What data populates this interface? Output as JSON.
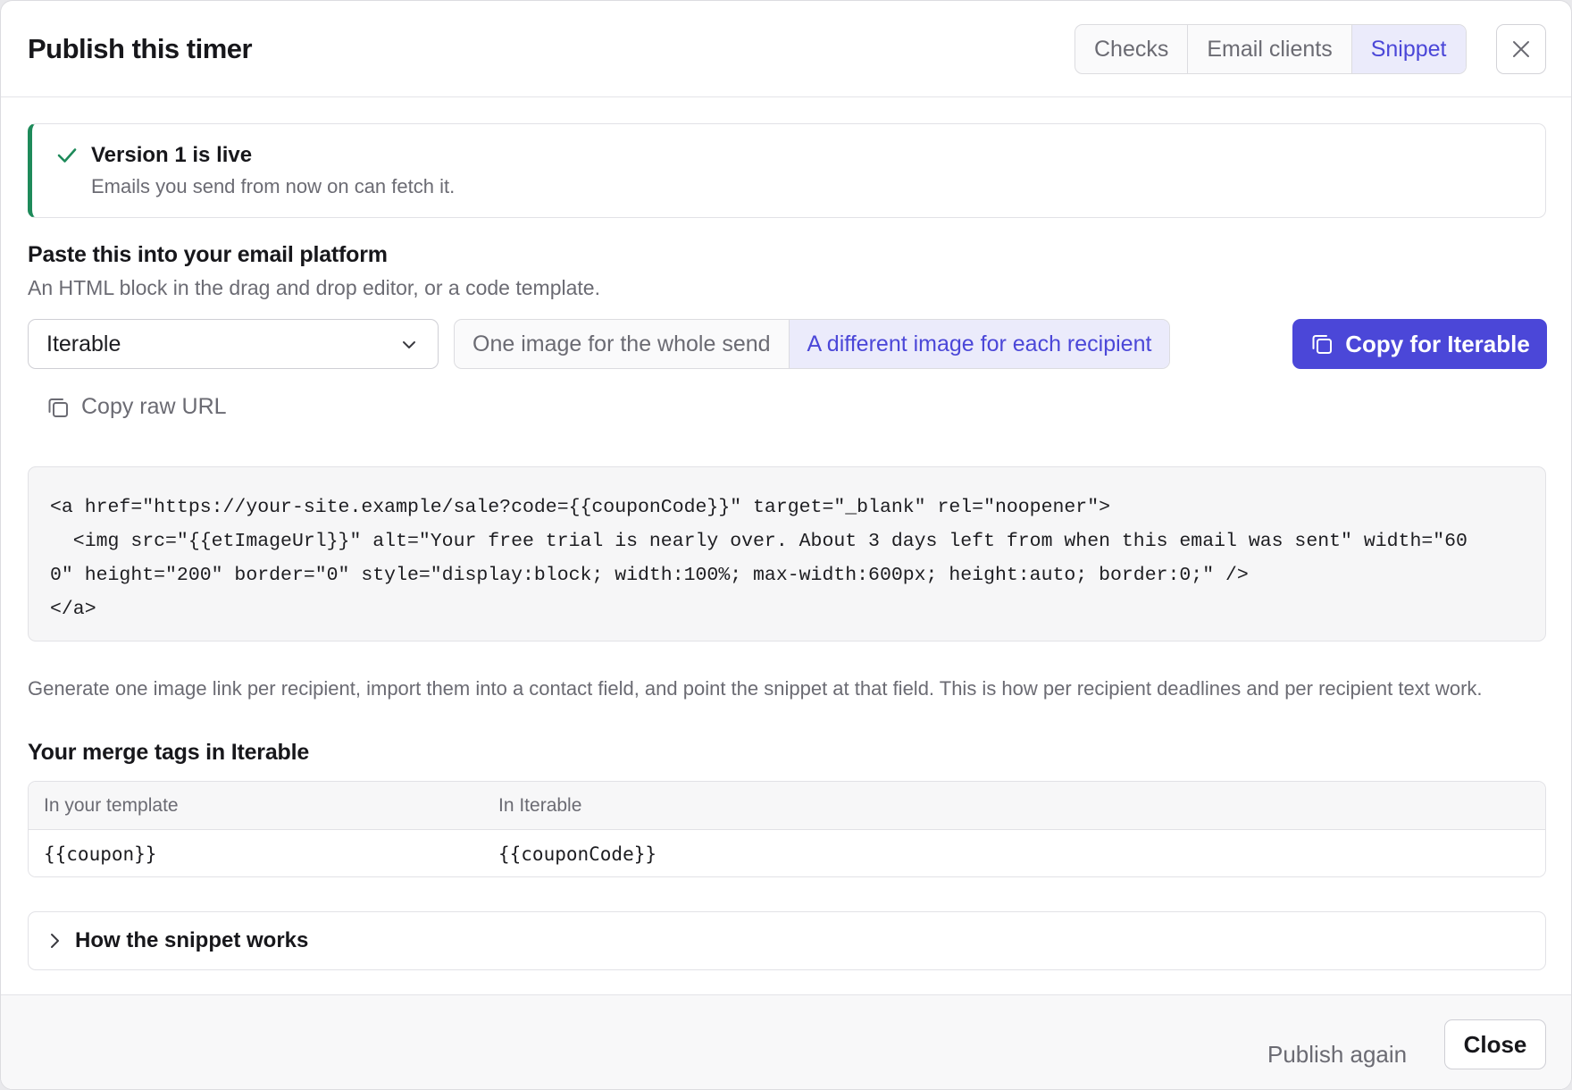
{
  "dialog": {
    "title": "Publish this timer",
    "tabs": [
      {
        "label": "Checks",
        "active": false
      },
      {
        "label": "Email clients",
        "active": false
      },
      {
        "label": "Snippet",
        "active": true
      }
    ],
    "close_icon": "close-icon"
  },
  "banner": {
    "icon": "check-icon",
    "title": "Version 1 is live",
    "subtitle": "Emails you send from now on can fetch it.",
    "accent_color": "#1e8a5a"
  },
  "paste_section": {
    "heading": "Paste this into your email platform",
    "subheading": "An HTML block in the drag and drop editor, or a code template.",
    "platform_select": {
      "value": "Iterable",
      "icon": "chevron-down-icon"
    },
    "mode_options": [
      {
        "label": "One image for the whole send",
        "active": false
      },
      {
        "label": "A different image for each recipient",
        "active": true
      }
    ],
    "copy_button": {
      "label": "Copy for Iterable",
      "icon": "copy-icon"
    },
    "copy_raw_url": {
      "label": "Copy raw URL",
      "icon": "copy-icon"
    }
  },
  "code_snippet": {
    "lines": [
      "<a href=\"https://your-site.example/sale?code={{couponCode}}\" target=\"_blank\" rel=\"noopener\">",
      "  <img src=\"{{etImageUrl}}\" alt=\"Your free trial is nearly over. About 3 days left from when this email was sent\" width=\"60",
      "0\" height=\"200\" border=\"0\" style=\"display:block; width:100%; max-width:600px; height:auto; border:0;\" />",
      "</a>"
    ]
  },
  "note": "Generate one image link per recipient, import them into a contact field, and point the snippet at that field. This is how per recipient deadlines and per recipient text work.",
  "merge_tags": {
    "heading": "Your merge tags in Iterable",
    "columns": [
      "In your template",
      "In Iterable"
    ],
    "rows": [
      [
        "{{coupon}}",
        "{{couponCode}}"
      ]
    ]
  },
  "details": {
    "label": "How the snippet works",
    "icon": "chevron-right-icon"
  },
  "footer": {
    "publish_again": "Publish again",
    "close": "Close"
  },
  "colors": {
    "accent": "#4b47d8",
    "accent_soft": "#ebebfb",
    "success": "#1e8a5a"
  }
}
